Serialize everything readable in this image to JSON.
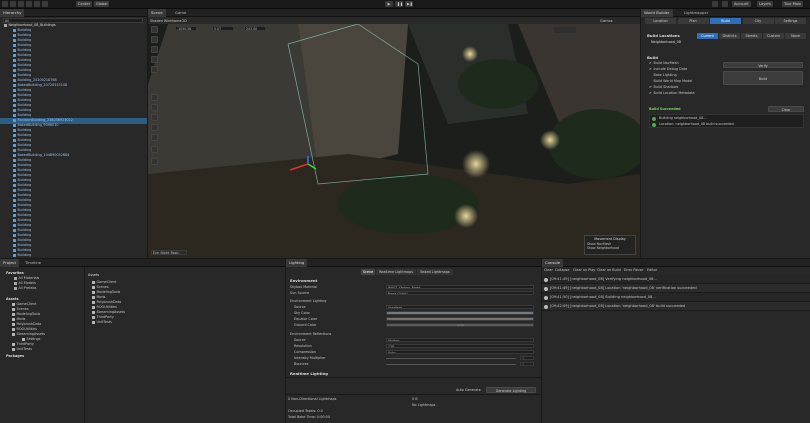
{
  "toolbar": {
    "center": "Center",
    "global": "Global",
    "account": "Account",
    "layers": "Layers",
    "layout": "Tour Main"
  },
  "hierarchy": {
    "tab": "Hierarchy",
    "search_placeholder": "All",
    "root": "Neighborhood_08_Buildings",
    "items": [
      "Building",
      "Building",
      "Building",
      "Building",
      "Building",
      "Building",
      "Building",
      "Building",
      "Building",
      "Building",
      "Building_20200218768",
      "BakedBuilding_20720515108",
      "Building",
      "Building",
      "Building",
      "Building",
      "Building",
      "Building",
      "RandomBuilding_238036923022",
      "BakedBuilding_9098010",
      "Building",
      "Building",
      "Building",
      "Building",
      "Building",
      "BakedBuilding_104890052684",
      "Building",
      "Building",
      "Building",
      "Building",
      "Building",
      "Building",
      "Building",
      "Building",
      "Building",
      "Building",
      "Building",
      "Building",
      "Building",
      "Building",
      "Building",
      "Building",
      "Building",
      "Building",
      "Building",
      "Building",
      "Building",
      "Building"
    ],
    "selected_index": 18
  },
  "scene_view": {
    "tabs": [
      "Scene",
      "Game"
    ],
    "shading": "Shaded Wireframe",
    "twod": "2D",
    "coords": [
      "-1050.58",
      "5.07",
      "243.00"
    ],
    "gizmos": "Gizmos",
    "overlay_title": "Movement Display",
    "overlay_items": [
      "Show NavMesh",
      "Show Neighborhood"
    ],
    "dropdown": "Eve_Night_Basic"
  },
  "world_builder": {
    "tabs": [
      "World Builder",
      "Lightmapper"
    ],
    "nav_tabs": [
      "Location",
      "Plan",
      "Build",
      "City",
      "Settings"
    ],
    "nav_active": 2,
    "build_locations": "Build Locations",
    "location_name": "Neighborhood_08",
    "sub_tabs": [
      "Current",
      "Districts",
      "Streets",
      "Custom",
      "None"
    ],
    "sub_active": 0,
    "build_label": "Build",
    "checks": [
      "Build NavMesh",
      "Include Debug Data",
      "Bake Lighting",
      "Build World Map Model",
      "Build Shadows",
      "Build Location Metadata"
    ],
    "checked": [
      true,
      true,
      false,
      false,
      true,
      true
    ],
    "verify": "Verify",
    "build_btn": "Build",
    "succeeded": "Build Succeeded",
    "clear": "Clear",
    "log": [
      "Building neighborhood_08...",
      "Location: neighborhood_08 build succeeded"
    ]
  },
  "project": {
    "tabs": [
      "Project",
      "Timeline"
    ],
    "favorites": "Favorites",
    "fav_items": [
      "All Materials",
      "All Models",
      "All Prefabs"
    ],
    "assets": "Assets",
    "tree": [
      "GameClient",
      "Scenes",
      "ModelingTools",
      "Mods",
      "PolybrushData",
      "ROGUtilities",
      "StreamingAssets",
      "Settings",
      "ThirdParty",
      "UnitTests"
    ],
    "packages": "Packages",
    "folder_header": "Assets",
    "folders": [
      "GameClient",
      "Scenes",
      "ModelingTools",
      "Mods",
      "PolybrushData",
      "ROGUtilities",
      "StreamingAssets",
      "ThirdParty",
      "UnitTests"
    ]
  },
  "lighting": {
    "tab": "Lighting",
    "subtabs": [
      "Scene",
      "Realtime Lightmaps",
      "Baked Lightmaps"
    ],
    "env_section": "Environment",
    "skybox": {
      "label": "Skybox Material",
      "value": "WAST_Skybox_Night"
    },
    "sun": {
      "label": "Sun Source",
      "value": "None (Light)"
    },
    "env_lighting": "Environment Lighting",
    "source": {
      "label": "Source",
      "value": "Gradient"
    },
    "sky": "Sky Color",
    "equator": "Equator Color",
    "ground": "Ground Color",
    "ground_val": "HDR",
    "env_refl": "Environment Reflections",
    "refl_source": {
      "label": "Source",
      "value": "Skybox"
    },
    "resolution": {
      "label": "Resolution",
      "value": "128"
    },
    "compression": {
      "label": "Compression",
      "value": "Auto"
    },
    "intensity": {
      "label": "Intensity Multiplier",
      "value": "1"
    },
    "bounces": {
      "label": "Bounces",
      "value": "1"
    },
    "realtime": "Realtime Lighting",
    "auto_gen": "Auto Generate",
    "generate": "Generate Lighting",
    "stats": [
      "0 Non-Directional Lightmaps",
      "Occupied Texels: 0.0",
      "Total Bake Time: 0:00:00"
    ],
    "stats_vals": [
      "0 B",
      "No Lightmaps"
    ]
  },
  "console": {
    "tab": "Console",
    "buttons": [
      "Clear",
      "Collapse",
      "Clear on Play",
      "Clear on Build",
      "Error Pause",
      "Editor"
    ],
    "entries": [
      "[09:41:49] [neighborhood_08] Verifying neighborhood_08...",
      "[09:41:49] [neighborhood_08] Location 'neighborhood_08' verification succeeded",
      "[09:41:50] [neighborhood_08] Building neighborhood_08...",
      "[09:42:09] [neighborhood_08] Location 'neighborhood_08' build succeeded"
    ]
  }
}
